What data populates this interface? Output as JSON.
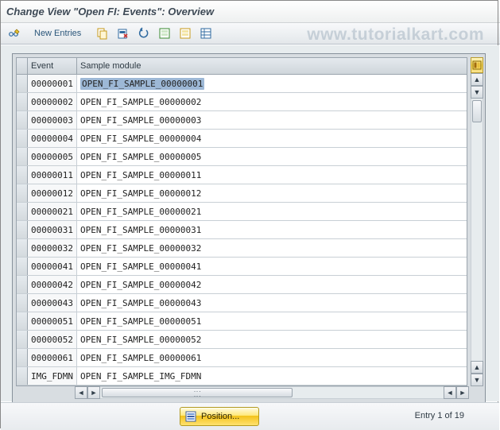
{
  "title": "Change View \"Open FI: Events\": Overview",
  "watermark": "www.tutorialkart.com",
  "toolbar": {
    "new_entries_label": "New Entries"
  },
  "grid": {
    "headers": {
      "event": "Event",
      "sample": "Sample module"
    },
    "rows": [
      {
        "event": "00000001",
        "sample": "OPEN_FI_SAMPLE_00000001"
      },
      {
        "event": "00000002",
        "sample": "OPEN_FI_SAMPLE_00000002"
      },
      {
        "event": "00000003",
        "sample": "OPEN_FI_SAMPLE_00000003"
      },
      {
        "event": "00000004",
        "sample": "OPEN_FI_SAMPLE_00000004"
      },
      {
        "event": "00000005",
        "sample": "OPEN_FI_SAMPLE_00000005"
      },
      {
        "event": "00000011",
        "sample": "OPEN_FI_SAMPLE_00000011"
      },
      {
        "event": "00000012",
        "sample": "OPEN_FI_SAMPLE_00000012"
      },
      {
        "event": "00000021",
        "sample": "OPEN_FI_SAMPLE_00000021"
      },
      {
        "event": "00000031",
        "sample": "OPEN_FI_SAMPLE_00000031"
      },
      {
        "event": "00000032",
        "sample": "OPEN_FI_SAMPLE_00000032"
      },
      {
        "event": "00000041",
        "sample": "OPEN_FI_SAMPLE_00000041"
      },
      {
        "event": "00000042",
        "sample": "OPEN_FI_SAMPLE_00000042"
      },
      {
        "event": "00000043",
        "sample": "OPEN_FI_SAMPLE_00000043"
      },
      {
        "event": "00000051",
        "sample": "OPEN_FI_SAMPLE_00000051"
      },
      {
        "event": "00000052",
        "sample": "OPEN_FI_SAMPLE_00000052"
      },
      {
        "event": "00000061",
        "sample": "OPEN_FI_SAMPLE_00000061"
      },
      {
        "event": "IMG_FDMN",
        "sample": "OPEN_FI_SAMPLE_IMG_FDMN"
      }
    ]
  },
  "footer": {
    "position_label": "Position...",
    "entry_text": "Entry 1 of 19"
  }
}
